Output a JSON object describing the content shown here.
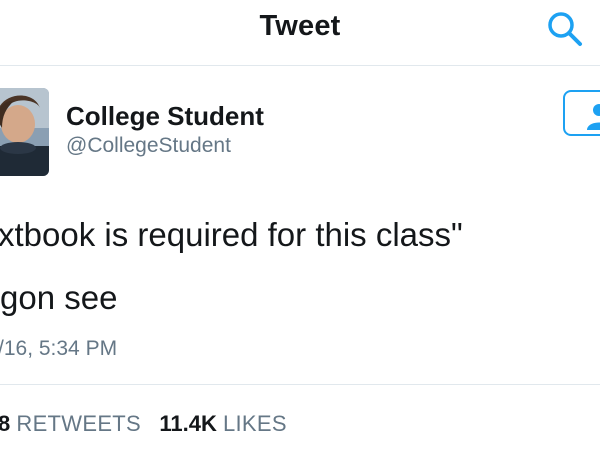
{
  "header": {
    "title": "Tweet",
    "search_icon": "search-icon"
  },
  "author": {
    "name": "College Student",
    "handle": "@CollegeStudent",
    "follow_icon": "follow-user-icon"
  },
  "tweet": {
    "line1": "xtbook is required for this class\"",
    "line2": "gon see",
    "timestamp": "/16, 5:34 PM"
  },
  "stats": {
    "retweets_count": "8",
    "retweets_label": "RETWEETS",
    "likes_count": "11.4K",
    "likes_label": "LIKES"
  },
  "colors": {
    "accent": "#1da1f2",
    "text_primary": "#14171a",
    "text_secondary": "#657786",
    "divider": "#e1e8ed"
  }
}
